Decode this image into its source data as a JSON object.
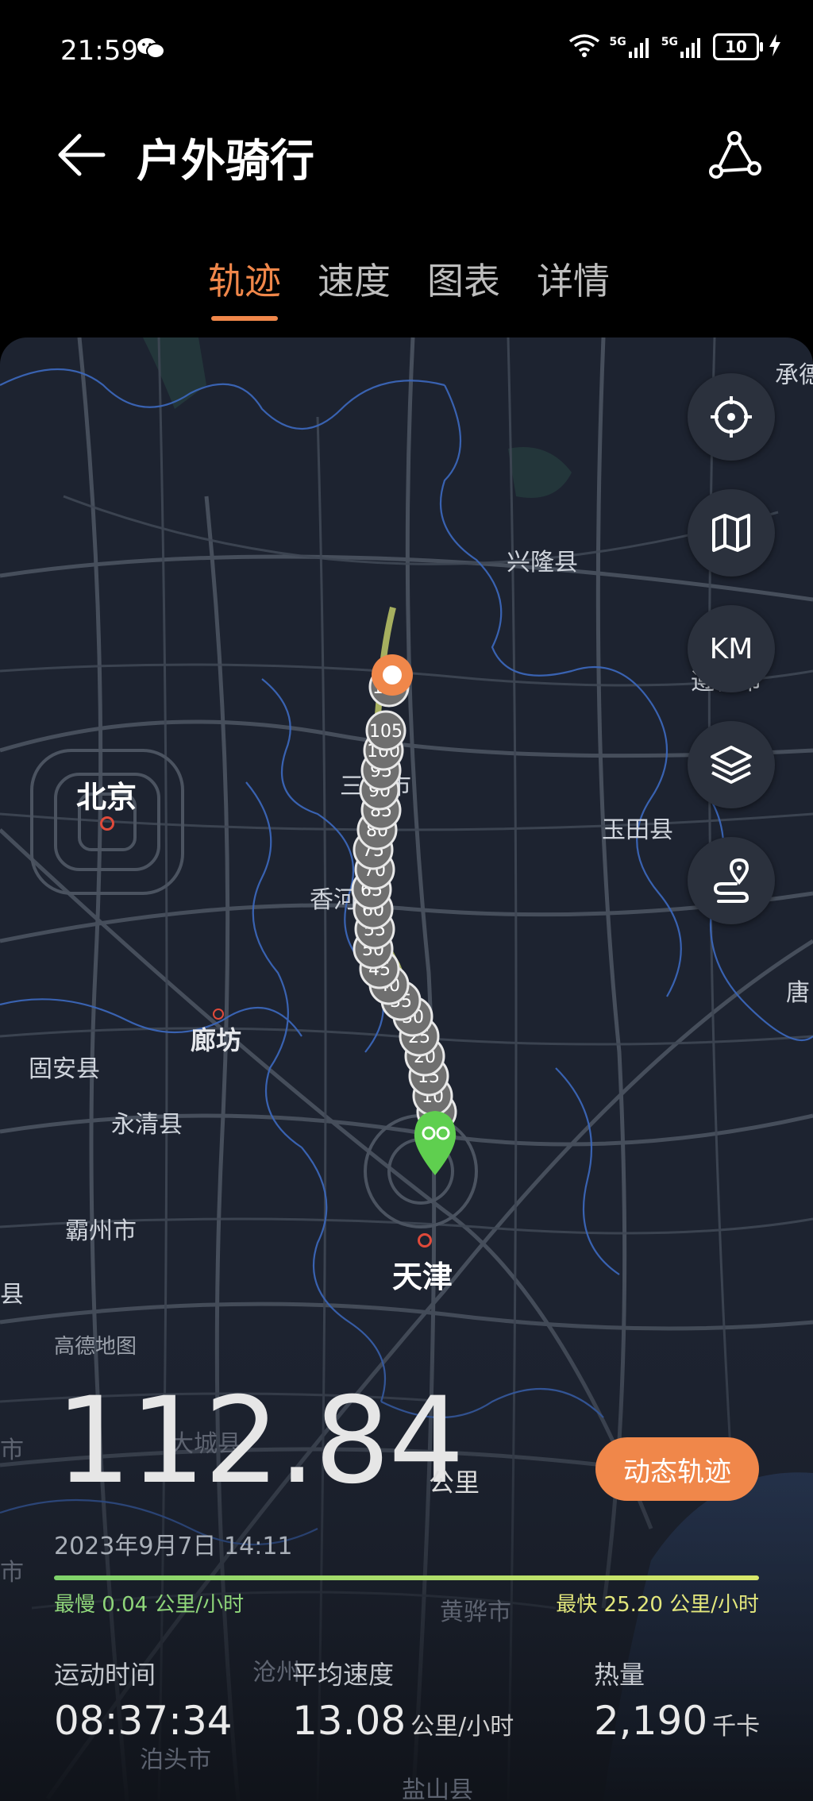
{
  "status_bar": {
    "time": "21:59",
    "network_1": "5G",
    "network_2": "5G",
    "battery": "10"
  },
  "header": {
    "title": "户外骑行"
  },
  "tabs": [
    {
      "label": "轨迹",
      "active": true
    },
    {
      "label": "速度",
      "active": false
    },
    {
      "label": "图表",
      "active": false
    },
    {
      "label": "详情",
      "active": false
    }
  ],
  "map": {
    "provider": "高德地图",
    "cities": {
      "beijing": "北京",
      "tianjin": "天津",
      "langfang": "廊坊",
      "sanhe": "三河市",
      "xianghe": "香河",
      "xinglong": "兴隆县",
      "yutian": "玉田县",
      "zunhua": "遵化市",
      "chengde": "承德",
      "tang": "唐",
      "guan": "固安县",
      "yongqing": "永清县",
      "bazhou": "霸州市",
      "dacheng": "大城县",
      "huanghua": "黄骅市",
      "cangzhou": "沧州",
      "botou": "泊头市",
      "yanshan": "盐山县",
      "xian": "县",
      "shi1": "市",
      "shi2": "市"
    },
    "km_marker_labels": [
      "5",
      "10",
      "15",
      "20",
      "25",
      "30",
      "35",
      "40",
      "45",
      "50",
      "55",
      "60",
      "65",
      "70",
      "75",
      "80",
      "85",
      "90",
      "95",
      "100",
      "105",
      "110"
    ],
    "controls": {
      "locate": "locate-icon",
      "map_type": "map-icon",
      "km": "KM",
      "layers": "layers-icon",
      "route": "route-icon"
    }
  },
  "summary": {
    "distance": "112.84",
    "distance_unit": "公里",
    "replay_button": "动态轨迹",
    "datetime": "2023年9月7日 14:11",
    "slowest": "最慢 0.04 公里/小时",
    "fastest": "最快 25.20 公里/小时",
    "stats": [
      {
        "label": "运动时间",
        "value": "08:37:34",
        "unit": ""
      },
      {
        "label": "平均速度",
        "value": "13.08",
        "unit": "公里/小时"
      },
      {
        "label": "热量",
        "value": "2,190",
        "unit": "千卡"
      }
    ]
  },
  "colors": {
    "accent": "#f0874a",
    "start_marker": "#5fcf4f",
    "map_bg": "#1d2330"
  }
}
